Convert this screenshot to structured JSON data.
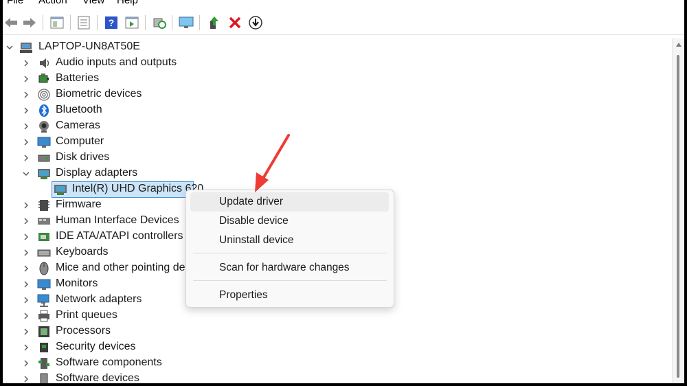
{
  "menubar": {
    "file": "File",
    "action": "Action",
    "view": "View",
    "help": "Help"
  },
  "toolbar": {
    "buttons": [
      "back-icon",
      "forward-icon",
      "show-hide-console-tree-icon",
      "properties-icon",
      "help-icon",
      "action-pane-icon",
      "scan-hardware-icon",
      "display-monitor-icon",
      "update-driver-icon",
      "uninstall-icon",
      "disable-icon"
    ],
    "accent_red": "#e0141e",
    "accent_green": "#2e9a3a"
  },
  "tree": {
    "root": "LAPTOP-UN8AT50E",
    "categories": [
      {
        "label": "Audio inputs and outputs",
        "icon": "speaker-icon"
      },
      {
        "label": "Batteries",
        "icon": "battery-icon"
      },
      {
        "label": "Biometric devices",
        "icon": "fingerprint-icon"
      },
      {
        "label": "Bluetooth",
        "icon": "bluetooth-icon"
      },
      {
        "label": "Cameras",
        "icon": "camera-icon"
      },
      {
        "label": "Computer",
        "icon": "computer-icon"
      },
      {
        "label": "Disk drives",
        "icon": "disk-drive-icon"
      },
      {
        "label": "Display adapters",
        "icon": "display-adapter-icon",
        "expanded": true
      },
      {
        "label": "Firmware",
        "icon": "firmware-icon"
      },
      {
        "label": "Human Interface Devices",
        "icon": "hid-icon"
      },
      {
        "label": "IDE ATA/ATAPI controllers",
        "icon": "ide-controller-icon"
      },
      {
        "label": "Keyboards",
        "icon": "keyboard-icon"
      },
      {
        "label": "Mice and other pointing devices",
        "icon": "mouse-icon"
      },
      {
        "label": "Monitors",
        "icon": "monitor-icon"
      },
      {
        "label": "Network adapters",
        "icon": "network-adapter-icon"
      },
      {
        "label": "Print queues",
        "icon": "printer-icon"
      },
      {
        "label": "Processors",
        "icon": "processor-icon"
      },
      {
        "label": "Security devices",
        "icon": "security-device-icon"
      },
      {
        "label": "Software components",
        "icon": "software-component-icon"
      },
      {
        "label": "Software devices",
        "icon": "software-device-icon"
      }
    ],
    "selected_child": "Intel(R) UHD Graphics 620"
  },
  "context_menu": {
    "items": [
      "Update driver",
      "Disable device",
      "Uninstall device",
      "Scan for hardware changes",
      "Properties"
    ],
    "highlighted": "Update driver"
  },
  "colors": {
    "annotation_arrow": "#ee3b33",
    "selection": "#cce4f7"
  }
}
